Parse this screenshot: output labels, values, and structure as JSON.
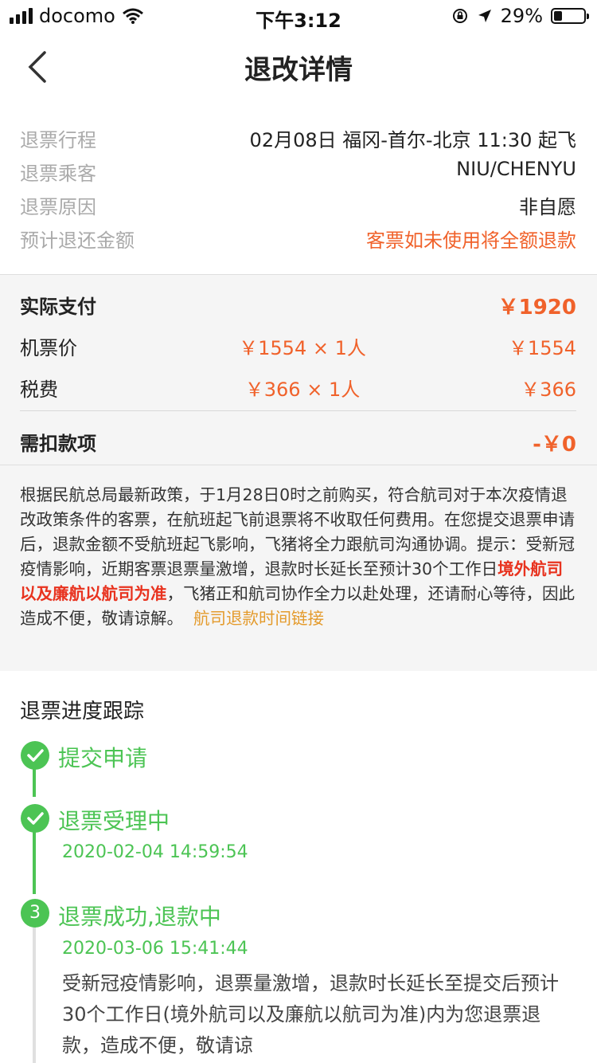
{
  "status_bar": {
    "carrier": "docomo",
    "time": "下午3:12",
    "battery_percent": "29%",
    "battery_level": 0.29
  },
  "nav": {
    "title": "退改详情"
  },
  "info": {
    "rows": [
      {
        "label": "退票行程",
        "value": "02月08日 福冈-首尔-北京 11:30 起飞"
      },
      {
        "label": "退票乘客",
        "value": "NIU/CHENYU"
      },
      {
        "label": "退票原因",
        "value": "非自愿"
      },
      {
        "label": "预计退还金额",
        "value": "客票如未使用将全额退款"
      }
    ]
  },
  "payment": {
    "actual_label": "实际支付",
    "actual_value": "￥1920",
    "ticket_label": "机票价",
    "ticket_unit": "￥1554 × 1人",
    "ticket_total": "￥1554",
    "tax_label": "税费",
    "tax_unit": "￥366 × 1人",
    "tax_total": "￥366",
    "deduct_label": "需扣款项",
    "deduct_value": "-￥0"
  },
  "notice": {
    "text_1": "根据民航总局最新政策，于1月28日0时之前购买，符合航司对于本次疫情退改政策条件的客票，在航班起飞前退票将不收取任何费用。在您提交退票申请后，退款金额不受航班起飞影响，飞猪将全力跟航司沟通协调。提示：受新冠疫情影响，近期客票退票量激增，退款时长延长至预计30个工作日",
    "highlight": "境外航司以及廉航以航司为准",
    "text_2": "，飞猪正和航司协作全力以赴处理，还请耐心等待，因此造成不便，敬请谅解。",
    "link": "航司退款时间链接"
  },
  "progress": {
    "title": "退票进度跟踪",
    "steps": [
      {
        "label": "提交申请",
        "time": "",
        "icon": "check-icon"
      },
      {
        "label": "退票受理中",
        "time": "2020-02-04 14:59:54",
        "icon": "check-icon"
      },
      {
        "label": "退票成功,退款中",
        "time": "2020-03-06 15:41:44",
        "number": "3",
        "desc": "受新冠疫情影响，退票量激增，退款时长延长至提交后预计30个工作日(境外航司以及廉航以航司为准)内为您退票退款，造成不便，敬请谅"
      }
    ]
  },
  "colors": {
    "accent_orange": "#f0622b",
    "success_green": "#4cc454",
    "alert_red": "#e8331f",
    "link_gold": "#e49b2d"
  }
}
